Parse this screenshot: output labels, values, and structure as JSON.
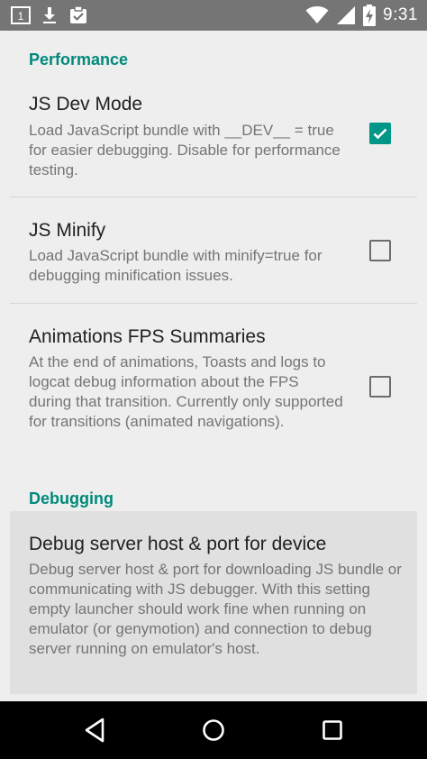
{
  "status_bar": {
    "time": "9:31",
    "left_icons": [
      "notification-icon",
      "download-icon",
      "clipboard-check-icon"
    ],
    "right_icons": [
      "wifi-icon",
      "signal-icon",
      "battery-charging-icon"
    ],
    "notification_badge": "1"
  },
  "sections": [
    {
      "category": "Performance",
      "prefs": [
        {
          "title": "JS Dev Mode",
          "summary": "Load JavaScript bundle with __DEV__ = true for easier debugging.  Disable for performance testing.",
          "checked": true
        },
        {
          "title": "JS Minify",
          "summary": "Load JavaScript bundle with minify=true for debugging minification issues.",
          "checked": false
        },
        {
          "title": "Animations FPS Summaries",
          "summary": "At the end of animations, Toasts and logs to logcat debug information about the FPS during that transition. Currently only supported for transitions (animated navigations).",
          "checked": false
        }
      ]
    },
    {
      "category": "Debugging",
      "prefs": [
        {
          "title": "Debug server host & port for device",
          "summary": "Debug server host & port for downloading JS bundle or communicating with JS debugger. With this setting empty launcher should work fine when running on emulator (or genymotion) and connection to debug server running on emulator's host."
        }
      ]
    }
  ],
  "nav_bar": {
    "buttons": [
      "back-icon",
      "home-icon",
      "recents-icon"
    ]
  },
  "colors": {
    "accent": "#009688",
    "category_text": "#00897b",
    "status_bar": "#757575",
    "background": "#eeeeee"
  }
}
